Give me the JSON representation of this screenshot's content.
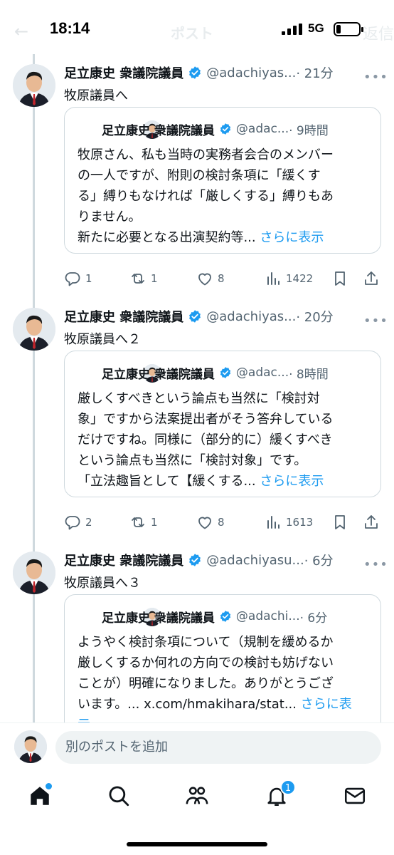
{
  "status_bar": {
    "time": "18:14",
    "network": "5G",
    "battery_fill": 0.2,
    "faint_back": "←",
    "faint_title": "ポスト",
    "faint_right": "返信"
  },
  "tweets": [
    {
      "name": "足立康史 衆議院議員",
      "handle": "@adachiyas...",
      "time": "· 21分",
      "text": "牧原議員へ",
      "quote": {
        "name": "足立康史 衆議院議員",
        "handle": "@adac...",
        "time": "· 9時間",
        "lines": [
          "牧原さん、私も当時の実務者会合のメンバー",
          "の一人ですが、附則の検討条項に「緩くす",
          "る」縛りもなければ「厳しくする」縛りもあ",
          "りません。",
          "新たに必要となる出演契約等... "
        ],
        "show_more": "さらに表示"
      },
      "replies": "1",
      "reposts": "1",
      "likes": "8",
      "views": "1422"
    },
    {
      "name": "足立康史 衆議院議員",
      "handle": "@adachiyas...",
      "time": "· 20分",
      "text": "牧原議員へ２",
      "quote": {
        "name": "足立康史 衆議院議員",
        "handle": "@adac...",
        "time": "· 8時間",
        "lines": [
          "厳しくすべきという論点も当然に「検討対",
          "象」ですから法案提出者がそう答弁している",
          "だけですね。同様に（部分的に）緩くすべき",
          "という論点も当然に「検討対象」です。",
          "「立法趣旨として【緩くする... "
        ],
        "show_more": "さらに表示"
      },
      "replies": "2",
      "reposts": "1",
      "likes": "8",
      "views": "1613"
    },
    {
      "name": "足立康史 衆議院議員",
      "handle": "@adachiyasu...",
      "time": "· 6分",
      "text": "牧原議員へ３",
      "quote": {
        "name": "足立康史 衆議院議員",
        "handle": "@adachi...",
        "time": "· 6分",
        "lines": [
          "ようやく検討条項について（規制を緩めるか",
          "厳しくするか何れの方向での検討も妨げない",
          "ことが）明確になりました。ありがとうござ",
          "います。... x.com/hmakihara/stat... ",
          "示"
        ],
        "show_more": "さらに表"
      }
    }
  ],
  "composer": {
    "placeholder": "別のポストを追加"
  },
  "nav": {
    "notifications_badge": "1"
  },
  "colors": {
    "accent": "#1d9bf0",
    "text": "#0f1419",
    "muted": "#536471",
    "border": "#cfd9de"
  },
  "icons": [
    "verified-badge-icon",
    "reply-icon",
    "repost-icon",
    "like-icon",
    "views-icon",
    "bookmark-icon",
    "share-icon",
    "home-icon",
    "search-icon",
    "communities-icon",
    "notifications-icon",
    "messages-icon"
  ]
}
